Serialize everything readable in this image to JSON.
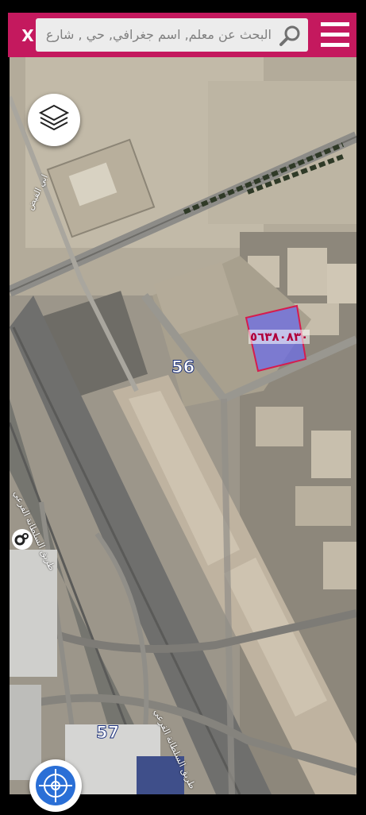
{
  "topbar": {
    "close_label": "X",
    "search_placeholder": "البحث عن معلم, اسم جغرافي, حي , شارع",
    "accent_color": "#c4195e"
  },
  "map": {
    "parcel_label": "٥٦٣٨٠٨٣٠",
    "route_labels": [
      "56",
      "57"
    ],
    "road_names": [
      "طريق السلطانة الفرعي",
      "طريق السلطانة الفرعي",
      "طريق السلطانة",
      "ابي الفيض"
    ]
  },
  "controls": {
    "layers": "layers-icon",
    "settings": "gear-icon",
    "locate": "crosshair-icon",
    "menu": "hamburger-icon",
    "search": "search-icon"
  }
}
